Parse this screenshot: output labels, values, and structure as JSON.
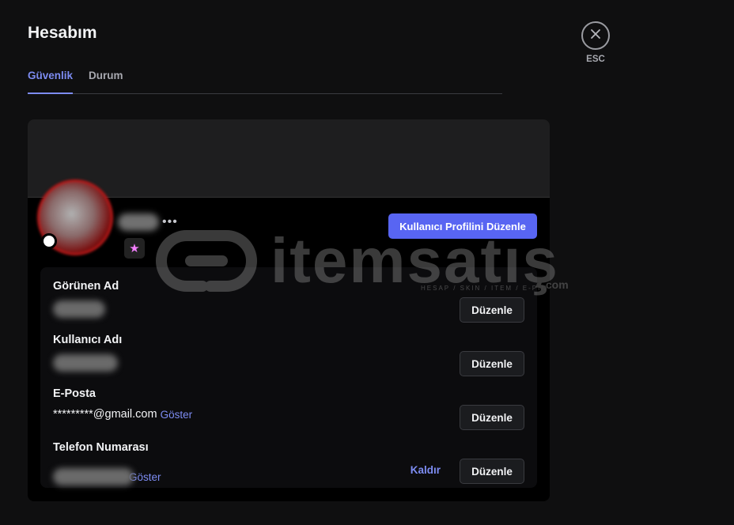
{
  "page": {
    "title": "Hesabım"
  },
  "tabs": [
    {
      "label": "Güvenlik",
      "active": true
    },
    {
      "label": "Durum",
      "active": false
    }
  ],
  "close": {
    "label": "ESC",
    "icon": "close-icon"
  },
  "profile": {
    "edit_profile_label": "Kullanıcı Profilini Düzenle",
    "more_icon": "more-icon",
    "badge_icon": "nitro-star-icon"
  },
  "fields": [
    {
      "label": "Görünen Ad",
      "value": "",
      "action": "Düzenle"
    },
    {
      "label": "Kullanıcı Adı",
      "value": "",
      "action": "Düzenle"
    },
    {
      "label": "E-Posta",
      "value": "*********@gmail.com",
      "reveal": "Göster",
      "action": "Düzenle"
    },
    {
      "label": "Telefon Numarası",
      "value": "",
      "reveal": "Göster",
      "remove": "Kaldır",
      "action": "Düzenle"
    }
  ],
  "watermark": {
    "brand": "itemsatış",
    "tagline": "HESAP / SKIN / ITEM / E-PIN",
    "suffix": ".com"
  },
  "colors": {
    "accent": "#5865f2",
    "link": "#7d8cf2",
    "background": "#0f0f10"
  }
}
